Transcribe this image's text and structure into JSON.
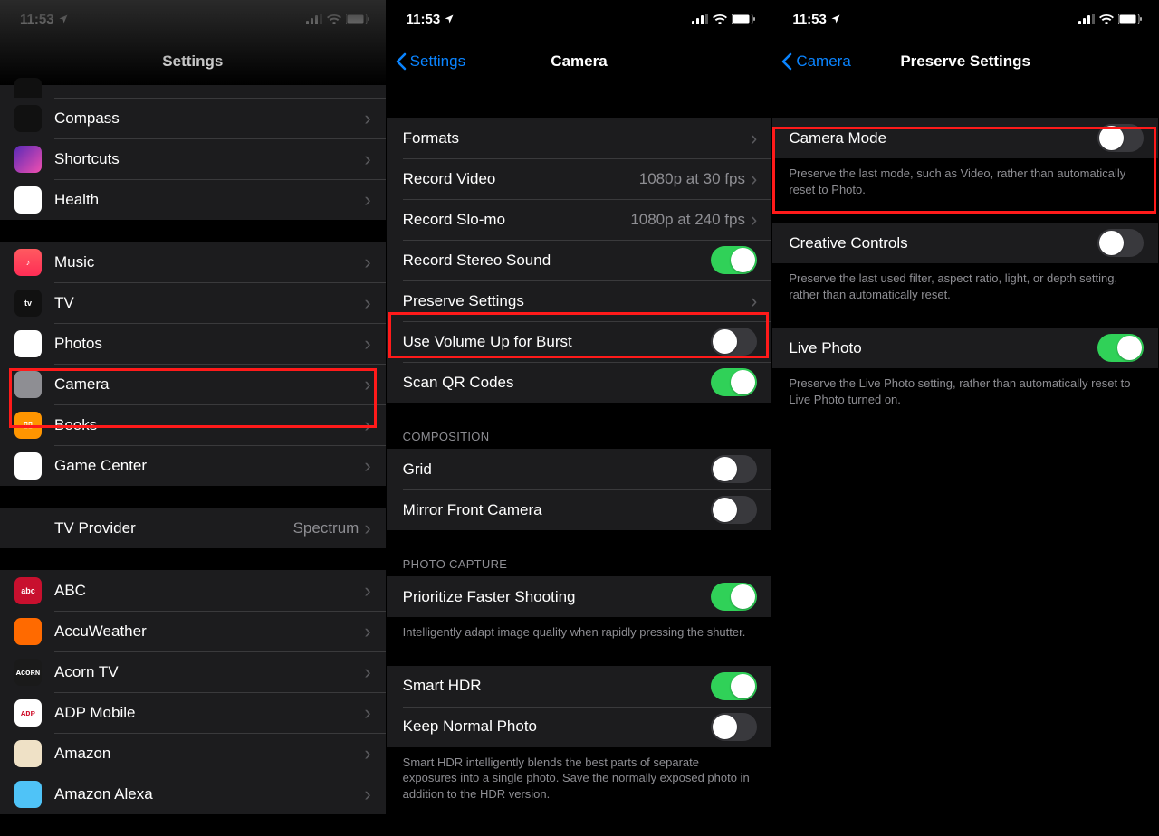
{
  "status": {
    "time": "11:53",
    "arrow": "➤"
  },
  "screen1": {
    "title": "Settings",
    "groups": [
      {
        "items": [
          {
            "label": "",
            "icon_bg": "#101010",
            "partial_top": true
          },
          {
            "label": "Compass",
            "icon_bg": "#111",
            "icon_fg": "#f66"
          },
          {
            "label": "Shortcuts",
            "icon_bg": "linear-gradient(135deg,#5a2ab7,#f04fb0)"
          },
          {
            "label": "Health",
            "icon_bg": "#fff",
            "icon_fg": "#ff2d55"
          }
        ]
      },
      {
        "items": [
          {
            "label": "Music",
            "icon_bg": "linear-gradient(#ff5a60,#ff2d55)",
            "icon_glyph": "♪"
          },
          {
            "label": "TV",
            "icon_bg": "#111",
            "icon_glyph": "tv",
            "icon_fg": "#fff"
          },
          {
            "label": "Photos",
            "icon_bg": "#fff"
          },
          {
            "label": "Camera",
            "icon_bg": "#8e8e93",
            "highlighted": true
          },
          {
            "label": "Books",
            "icon_bg": "#ff9500",
            "icon_glyph": "▯▯"
          },
          {
            "label": "Game Center",
            "icon_bg": "#fff"
          }
        ]
      },
      {
        "items": [
          {
            "label": "TV Provider",
            "icon_bg": "#1c1c1e",
            "detail": "Spectrum"
          }
        ]
      },
      {
        "items": [
          {
            "label": "ABC",
            "icon_bg": "#c8102e",
            "icon_glyph": "abc"
          },
          {
            "label": "AccuWeather",
            "icon_bg": "#ff6a00"
          },
          {
            "label": "Acorn TV",
            "icon_bg": "#1a1a1a",
            "icon_glyph": "ᴀᴄᴏʀɴ"
          },
          {
            "label": "ADP Mobile",
            "icon_bg": "#fff",
            "icon_fg": "#d0112b",
            "icon_glyph": "ᴀᴅᴘ"
          },
          {
            "label": "Amazon",
            "icon_bg": "#efe1c6"
          },
          {
            "label": "Amazon Alexa",
            "icon_bg": "#4fc3f7",
            "partial_bottom": true
          }
        ]
      }
    ]
  },
  "screen2": {
    "back": "Settings",
    "title": "Camera",
    "groups": [
      {
        "items": [
          {
            "label": "Formats",
            "type": "disclosure"
          },
          {
            "label": "Record Video",
            "type": "disclosure",
            "detail": "1080p at 30 fps"
          },
          {
            "label": "Record Slo-mo",
            "type": "disclosure",
            "detail": "1080p at 240 fps"
          },
          {
            "label": "Record Stereo Sound",
            "type": "toggle",
            "on": true
          },
          {
            "label": "Preserve Settings",
            "type": "disclosure",
            "highlighted": true
          },
          {
            "label": "Use Volume Up for Burst",
            "type": "toggle",
            "on": false
          },
          {
            "label": "Scan QR Codes",
            "type": "toggle",
            "on": true
          }
        ]
      },
      {
        "header": "COMPOSITION",
        "items": [
          {
            "label": "Grid",
            "type": "toggle",
            "on": false
          },
          {
            "label": "Mirror Front Camera",
            "type": "toggle",
            "on": false
          }
        ]
      },
      {
        "header": "PHOTO CAPTURE",
        "items": [
          {
            "label": "Prioritize Faster Shooting",
            "type": "toggle",
            "on": true
          }
        ],
        "footer": "Intelligently adapt image quality when rapidly pressing the shutter."
      },
      {
        "items": [
          {
            "label": "Smart HDR",
            "type": "toggle",
            "on": true
          },
          {
            "label": "Keep Normal Photo",
            "type": "toggle",
            "on": false
          }
        ],
        "footer": "Smart HDR intelligently blends the best parts of separate exposures into a single photo. Save the normally exposed photo in addition to the HDR version."
      }
    ]
  },
  "screen3": {
    "back": "Camera",
    "title": "Preserve Settings",
    "groups": [
      {
        "items": [
          {
            "label": "Camera Mode",
            "type": "toggle",
            "on": false,
            "highlighted": true
          }
        ],
        "footer": "Preserve the last mode, such as Video, rather than automatically reset to Photo.",
        "footer_in_highlight": true
      },
      {
        "items": [
          {
            "label": "Creative Controls",
            "type": "toggle",
            "on": false
          }
        ],
        "footer": "Preserve the last used filter, aspect ratio, light, or depth setting, rather than automatically reset."
      },
      {
        "items": [
          {
            "label": "Live Photo",
            "type": "toggle",
            "on": true
          }
        ],
        "footer": "Preserve the Live Photo setting, rather than automatically reset to Live Photo turned on."
      }
    ]
  }
}
